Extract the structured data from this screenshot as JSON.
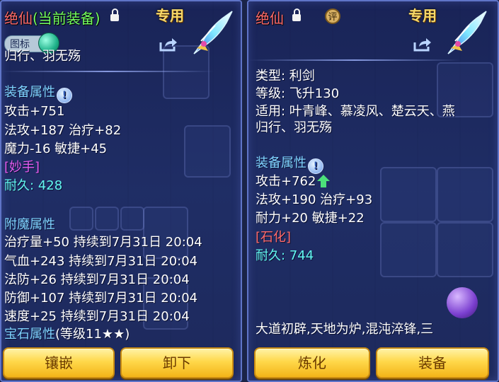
{
  "colors": {
    "name_red": "#ff6b6b",
    "equipped_green": "#74ff5f",
    "exclusive_gold": "#f5d86a",
    "section_blue": "#7fd3ff",
    "skill_pink": "#e55cf0",
    "durability_cyan": "#62f7f0",
    "seal_red": "#ff6a6a",
    "button_gold": "#ffd84a"
  },
  "left": {
    "name": "绝仙",
    "equipped_tag": "(当前装备)",
    "lock_icon": "lock-open-icon",
    "exclusive": "专用",
    "share_icon": "share-icon",
    "weapon_icon": "feather-sword-icon",
    "toggle_label": "图标",
    "suitable_tail": "归行、羽无殇",
    "section_attr": "装备属性",
    "attr1": "攻击+751",
    "attr2": "法攻+187 治疗+82",
    "attr3": "魔力-16 敏捷+45",
    "skill": "[妙手]",
    "durability_label": "耐久:",
    "durability_value": "428",
    "section_enchant": "附魔属性",
    "enchant": [
      "治疗量+50 持续到7月31日 20:04",
      "气血+243 持续到7月31日 20:04",
      "法防+26 持续到7月31日 20:04",
      "防御+107 持续到7月31日 20:04",
      "速度+25 持续到7月31日 20:04"
    ],
    "gem_label": "宝石属性",
    "gem_level": "(等级11★★)",
    "btn_inlay": "镶嵌",
    "btn_remove": "卸下"
  },
  "right": {
    "name": "绝仙",
    "lock_icon": "lock-open-icon",
    "rate_badge": "评",
    "exclusive": "专用",
    "share_icon": "share-icon",
    "weapon_icon": "feather-sword-icon",
    "type": "类型: 利剑",
    "level": "等级: 飞升130",
    "suitable1": "适用: 叶青峰、慕凌风、楚云天、燕",
    "suitable2": "归行、羽无殇",
    "section_attr": "装备属性",
    "attr1": "攻击+762",
    "attr2": "法攻+190 治疗+93",
    "attr3": "耐力+20 敏捷+22",
    "seal": "[石化]",
    "durability_label": "耐久:",
    "durability_value": "744",
    "desc1": "大道初辟,天地为炉,混沌淬锋,三",
    "btn_refine": "炼化",
    "btn_equip": "装备"
  }
}
